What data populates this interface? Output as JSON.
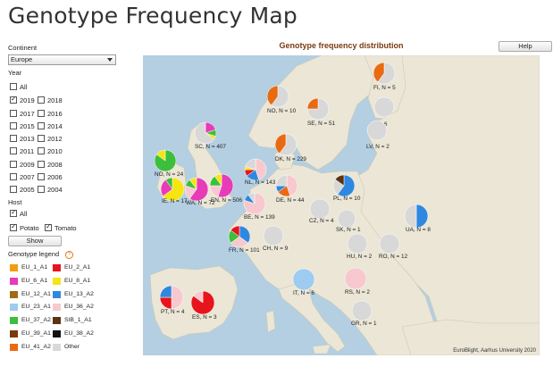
{
  "page": {
    "title": "Genotype Frequency Map"
  },
  "controls": {
    "continent_label": "Continent",
    "continent_value": "Europe",
    "year_label": "Year",
    "year_all": "All",
    "years": [
      {
        "a": "2019",
        "a_on": true,
        "b": "2018",
        "b_on": false
      },
      {
        "a": "2017",
        "a_on": false,
        "b": "2016",
        "b_on": false
      },
      {
        "a": "2015",
        "a_on": false,
        "b": "2014",
        "b_on": false
      },
      {
        "a": "2013",
        "a_on": false,
        "b": "2012",
        "b_on": false
      },
      {
        "a": "2011",
        "a_on": false,
        "b": "2010",
        "b_on": false
      },
      {
        "a": "2009",
        "a_on": false,
        "b": "2008",
        "b_on": false
      },
      {
        "a": "2007",
        "a_on": false,
        "b": "2006",
        "b_on": false
      },
      {
        "a": "2005",
        "a_on": false,
        "b": "2004",
        "b_on": false
      }
    ],
    "host_label": "Host",
    "host_all": "All",
    "host_potato": "Potato",
    "host_tomato": "Tomato",
    "show_button": "Show",
    "legend_title": "Genotype legend",
    "legend_help": "?",
    "help_button": "Help"
  },
  "legend": [
    {
      "a": "EU_1_A1",
      "ca": "#f39c12",
      "b": "EU_2_A1",
      "cb": "#e8141b"
    },
    {
      "a": "EU_6_A1",
      "ca": "#e83bb8",
      "b": "EU_8_A1",
      "cb": "#f5e512"
    },
    {
      "a": "EU_12_A1",
      "ca": "#a06a14",
      "b": "EU_13_A2",
      "cb": "#2f88e0"
    },
    {
      "a": "EU_23_A1",
      "ca": "#9ecbf0",
      "b": "EU_36_A2",
      "cb": "#f8c8cf"
    },
    {
      "a": "EU_37_A2",
      "ca": "#3cbf3c",
      "b": "SIB_1_A1",
      "cb": "#5a3414"
    },
    {
      "a": "EU_39_A1",
      "ca": "#7a3a10",
      "b": "EU_38_A2",
      "cb": "#111111"
    },
    {
      "a": "EU_41_A2",
      "ca": "#e86a12",
      "b": "Other",
      "cb": "#d8d8d8"
    }
  ],
  "map": {
    "title": "Genotype frequency distribution",
    "credit": "EuroBlight, Aarhus University 2020",
    "colors": {
      "sea": "#b3cfe1",
      "land": "#ebe6d6"
    },
    "countries": [
      {
        "label": "NO, N = 10",
        "parts": [
          [
            "#d8d8d8",
            0.6
          ],
          [
            "#e86a12",
            0.4
          ]
        ]
      },
      {
        "label": "SE, N = 51",
        "parts": [
          [
            "#d8d8d8",
            0.75
          ],
          [
            "#e86a12",
            0.25
          ]
        ]
      },
      {
        "label": "FI, N = 5",
        "parts": [
          [
            "#d8d8d8",
            0.6
          ],
          [
            "#e86a12",
            0.4
          ]
        ]
      },
      {
        "label": "N = 6",
        "parts": [
          [
            "#d8d8d8",
            1.0
          ]
        ]
      },
      {
        "label": "LV, N = 2",
        "parts": [
          [
            "#d8d8d8",
            1.0
          ]
        ]
      },
      {
        "label": "DK, N = 229",
        "parts": [
          [
            "#d8d8d8",
            0.6
          ],
          [
            "#e86a12",
            0.4
          ]
        ]
      },
      {
        "label": "SC, N = 407",
        "parts": [
          [
            "#e83bb8",
            0.2
          ],
          [
            "#3cbf3c",
            0.1
          ],
          [
            "#f5e512",
            0.05
          ],
          [
            "#d8d8d8",
            0.65
          ]
        ]
      },
      {
        "label": "NO, N = 24",
        "parts": [
          [
            "#3cbf3c",
            0.85
          ],
          [
            "#f5e512",
            0.15
          ]
        ]
      },
      {
        "label": "IE, N = 17",
        "parts": [
          [
            "#f5e512",
            0.65
          ],
          [
            "#e83bb8",
            0.25
          ],
          [
            "#3cbf3c",
            0.1
          ]
        ]
      },
      {
        "label": "WA, N = 72",
        "parts": [
          [
            "#e83bb8",
            0.6
          ],
          [
            "#f8c8cf",
            0.2
          ],
          [
            "#3cbf3c",
            0.1
          ],
          [
            "#f5e512",
            0.1
          ]
        ]
      },
      {
        "label": "EN, N = 506",
        "parts": [
          [
            "#e83bb8",
            0.55
          ],
          [
            "#f8c8cf",
            0.2
          ],
          [
            "#3cbf3c",
            0.15
          ],
          [
            "#f5e512",
            0.1
          ]
        ]
      },
      {
        "label": "NL, N = 143",
        "parts": [
          [
            "#f8c8cf",
            0.45
          ],
          [
            "#2f88e0",
            0.2
          ],
          [
            "#e8141b",
            0.1
          ],
          [
            "#f5e512",
            0.05
          ],
          [
            "#d8d8d8",
            0.2
          ]
        ]
      },
      {
        "label": "DE, N = 44",
        "parts": [
          [
            "#f8c8cf",
            0.45
          ],
          [
            "#e86a12",
            0.2
          ],
          [
            "#2f88e0",
            0.1
          ],
          [
            "#d8d8d8",
            0.25
          ]
        ]
      },
      {
        "label": "BE, N = 139",
        "parts": [
          [
            "#f8c8cf",
            0.8
          ],
          [
            "#2f88e0",
            0.1
          ],
          [
            "#d8d8d8",
            0.1
          ]
        ]
      },
      {
        "label": "PL, N = 10",
        "parts": [
          [
            "#2f88e0",
            0.6
          ],
          [
            "#d8d8d8",
            0.25
          ],
          [
            "#5a3414",
            0.15
          ]
        ]
      },
      {
        "label": "CZ, N = 4",
        "parts": [
          [
            "#d8d8d8",
            1.0
          ]
        ]
      },
      {
        "label": "SK, N = 1",
        "parts": [
          [
            "#d8d8d8",
            1.0
          ]
        ]
      },
      {
        "label": "UA, N = 8",
        "parts": [
          [
            "#2f88e0",
            0.5
          ],
          [
            "#d8d8d8",
            0.5
          ]
        ]
      },
      {
        "label": "FR, N = 101",
        "parts": [
          [
            "#2f88e0",
            0.35
          ],
          [
            "#f8c8cf",
            0.3
          ],
          [
            "#3cbf3c",
            0.2
          ],
          [
            "#e8141b",
            0.15
          ]
        ]
      },
      {
        "label": "CH, N = 9",
        "parts": [
          [
            "#d8d8d8",
            1.0
          ]
        ]
      },
      {
        "label": "HU, N = 2",
        "parts": [
          [
            "#d8d8d8",
            1.0
          ]
        ]
      },
      {
        "label": "RO, N = 12",
        "parts": [
          [
            "#d8d8d8",
            1.0
          ]
        ]
      },
      {
        "label": "IT, N = 6",
        "parts": [
          [
            "#9ecbf0",
            1.0
          ]
        ]
      },
      {
        "label": "RS, N = 2",
        "parts": [
          [
            "#f8c8cf",
            1.0
          ]
        ]
      },
      {
        "label": "PT, N = 4",
        "parts": [
          [
            "#f8c8cf",
            0.5
          ],
          [
            "#e8141b",
            0.25
          ],
          [
            "#2f88e0",
            0.25
          ]
        ]
      },
      {
        "label": "ES, N = 3",
        "parts": [
          [
            "#e8141b",
            0.85
          ],
          [
            "#f8c8cf",
            0.15
          ]
        ]
      },
      {
        "label": "GR, N = 1",
        "parts": [
          [
            "#d8d8d8",
            1.0
          ]
        ]
      }
    ]
  }
}
